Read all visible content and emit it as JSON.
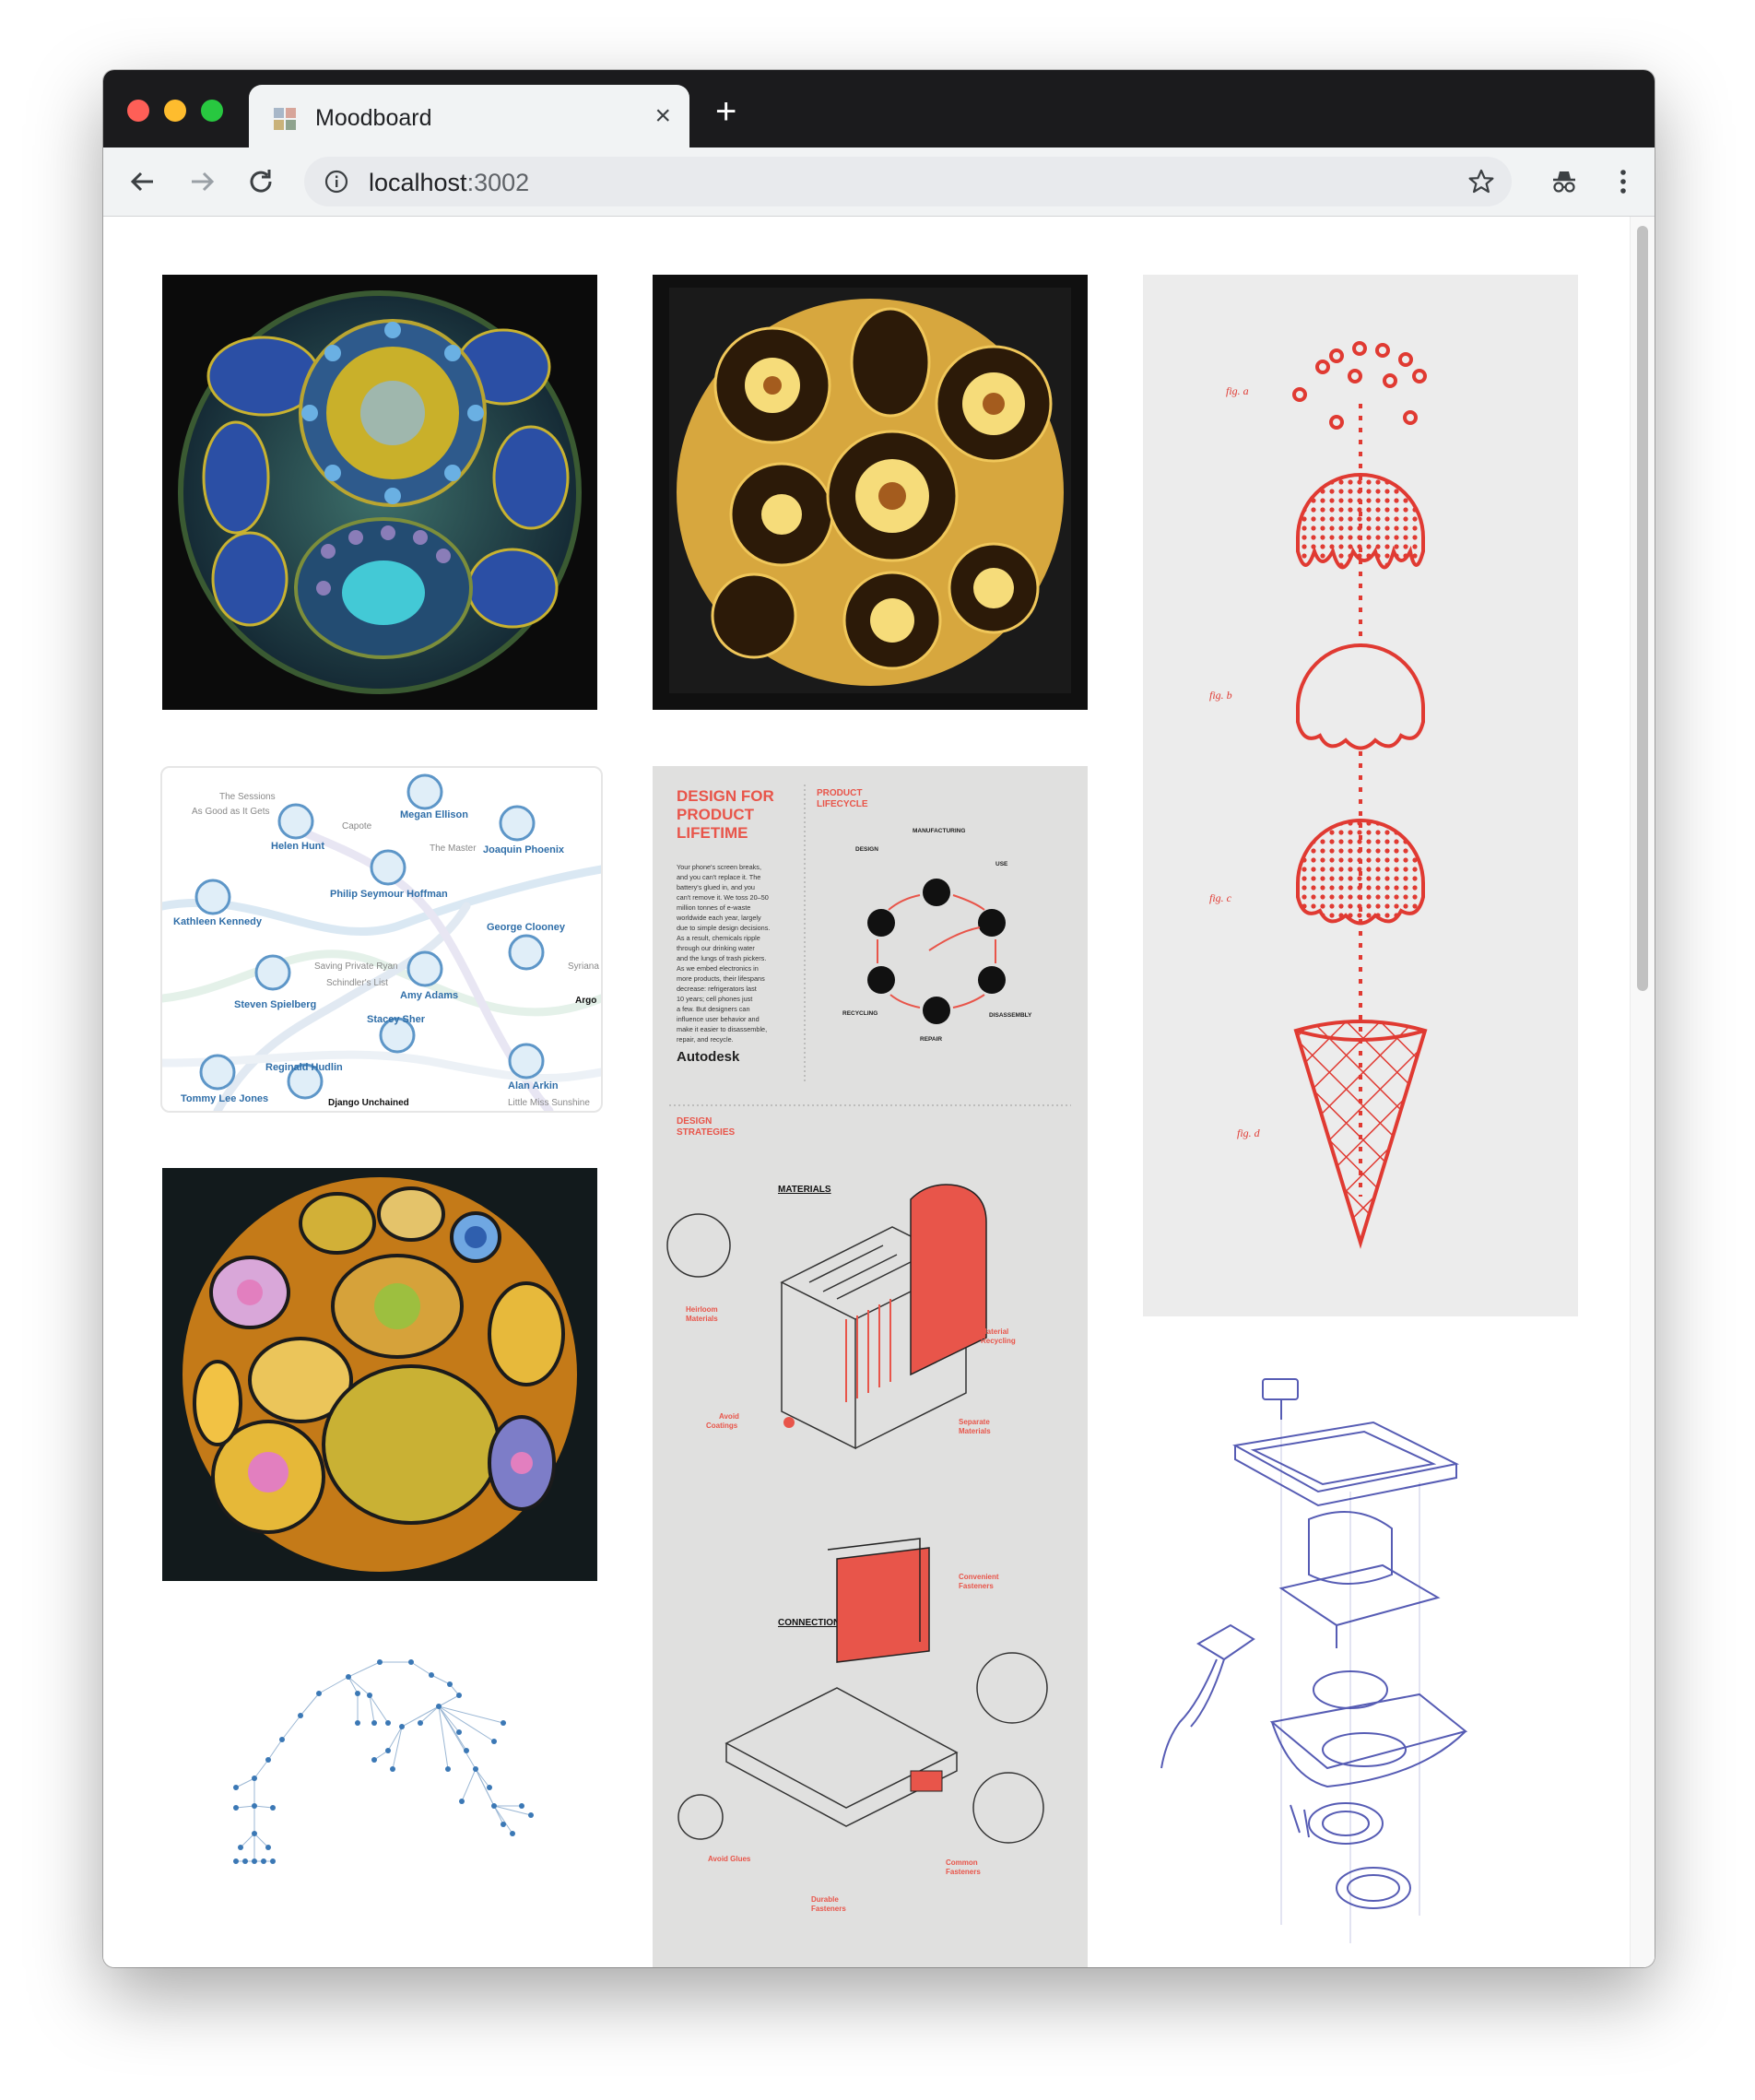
{
  "window": {
    "tab_title": "Moodboard",
    "url_host": "localhost",
    "url_port": ":3002"
  },
  "icons": {
    "back": "arrow-left-icon",
    "forward": "arrow-right-icon",
    "reload": "reload-icon",
    "info": "info-icon",
    "bookmark": "star-icon",
    "incognito": "incognito-icon",
    "menu": "kebab-menu-icon"
  },
  "colors": {
    "tab_strip": "#1b1b1d",
    "toolbar": "#f1f3f4",
    "accent_red": "#e03a32",
    "infographic_red": "#e8554a",
    "network_blue": "#3b78b5"
  },
  "network": {
    "labels": [
      "The Sessions",
      "As Good as It Gets",
      "Megan Ellison",
      "Helen Hunt",
      "Capote",
      "The Master",
      "Joaquin Phoenix",
      "Philip Seymour Hoffman",
      "Kathleen Kennedy",
      "George Clooney",
      "Saving Private Ryan",
      "Schindler's List",
      "Syriana",
      "Amy Adams",
      "Steven Spielberg",
      "Argo",
      "Stacey Sher",
      "Reginald Hudlin",
      "Alan Arkin",
      "Tommy Lee Jones",
      "Django Unchained",
      "Little Miss Sunshine"
    ]
  },
  "infographic": {
    "title1": "DESIGN FOR",
    "title2": "PRODUCT",
    "title3": "LIFETIME",
    "lifecycle_title1": "PRODUCT",
    "lifecycle_title2": "LIFECYCLE",
    "body_lines": [
      "Your phone's screen breaks,",
      "and you can't replace it. The",
      "battery's glued in, and you",
      "can't remove it. We toss 20–50",
      "million tonnes of e-waste",
      "worldwide each year, largely",
      "due to simple design decisions.",
      "As a result, chemicals ripple",
      "through our drinking water",
      "and the lungs of trash pickers.",
      "As we embed electronics in",
      "more products, their lifespans",
      "decrease: refrigerators last",
      "10 years; cell phones just",
      "a few. But designers can",
      "influence user behavior and",
      "make it easier to disassemble,",
      "repair, and recycle."
    ],
    "brand": "Autodesk",
    "cycle_labels": [
      "MANUFACTURING",
      "DESIGN",
      "USE",
      "RECYCLING",
      "REPAIR",
      "DISASSEMBLY"
    ],
    "strategies_title1": "DESIGN",
    "strategies_title2": "STRATEGIES",
    "materials_title": "MATERIALS",
    "connections_title": "CONNECTIONS",
    "strategy_labels": [
      "Heirloom",
      "Materials",
      "Material",
      "Recycling",
      "Avoid",
      "Coatings",
      "Separate",
      "Materials",
      "Convenient",
      "Fasteners",
      "Avoid Glues",
      "Durable",
      "Fasteners",
      "Common",
      "Fasteners"
    ]
  },
  "icecream": {
    "fig_labels": [
      "fig. a",
      "fig. b",
      "fig. c",
      "fig. d"
    ]
  }
}
